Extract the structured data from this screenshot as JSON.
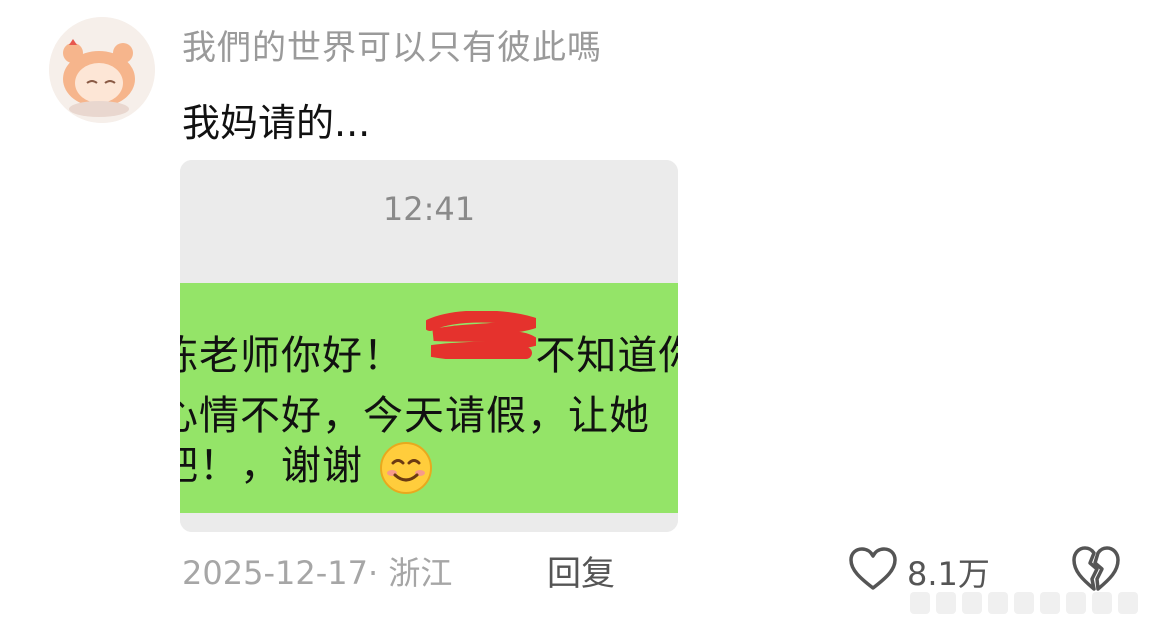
{
  "comment": {
    "username": "我們的世界可以只有彼此嗎",
    "text": "我妈请的...",
    "date_location": "2025-12-17· 浙江",
    "reply_label": "回复",
    "like_count": "8.1万",
    "avatar_icon": "cartoon-hamster-girl-avatar"
  },
  "attachment": {
    "chat_time": "12:41",
    "message_lines": [
      "陈老师你好！",
      "不知道你",
      "心情不好，今天请假，让她",
      "吧！，谢谢"
    ],
    "emoji": "smiling-face-emoji",
    "redaction_color": "#e5322d",
    "bubble_color": "#94e468"
  },
  "icons": {
    "like": "heart-outline-icon",
    "dislike": "broken-heart-icon"
  }
}
